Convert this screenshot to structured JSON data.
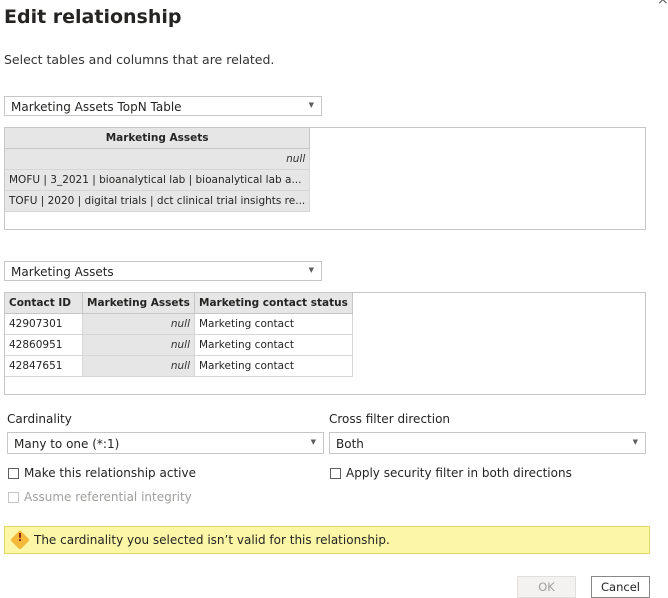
{
  "dialog": {
    "title": "Edit relationship",
    "close_glyph": "×",
    "subtitle": "Select tables and columns that are related."
  },
  "table1": {
    "selected": "Marketing Assets TopN Table",
    "columns": [
      "Marketing Assets"
    ],
    "rows": [
      [
        "null"
      ],
      [
        "MOFU | 3_2021 | bioanalytical lab | bioanalytical lab a..."
      ],
      [
        "TOFU | 2020 | digital trials | dct clinical trial insights re..."
      ]
    ]
  },
  "table2": {
    "selected": "Marketing Assets",
    "columns": [
      "Contact ID",
      "Marketing Assets",
      "Marketing contact status"
    ],
    "rows": [
      [
        "42907301",
        "null",
        "Marketing contact"
      ],
      [
        "42860951",
        "null",
        "Marketing contact"
      ],
      [
        "42847651",
        "null",
        "Marketing contact"
      ]
    ]
  },
  "cardinality": {
    "label": "Cardinality",
    "value": "Many to one (*:1)"
  },
  "cross_filter": {
    "label": "Cross filter direction",
    "value": "Both"
  },
  "options": {
    "make_active": "Make this relationship active",
    "referential_integrity": "Assume referential integrity",
    "security_filter": "Apply security filter in both directions"
  },
  "warning": {
    "icon": "warning-icon",
    "glyph": "!",
    "text": "The cardinality you selected isn’t valid for this relationship."
  },
  "buttons": {
    "ok": "OK",
    "cancel": "Cancel"
  },
  "colors": {
    "warning_bg": "#fbf7a7",
    "header_bg": "#e6e6e6"
  }
}
